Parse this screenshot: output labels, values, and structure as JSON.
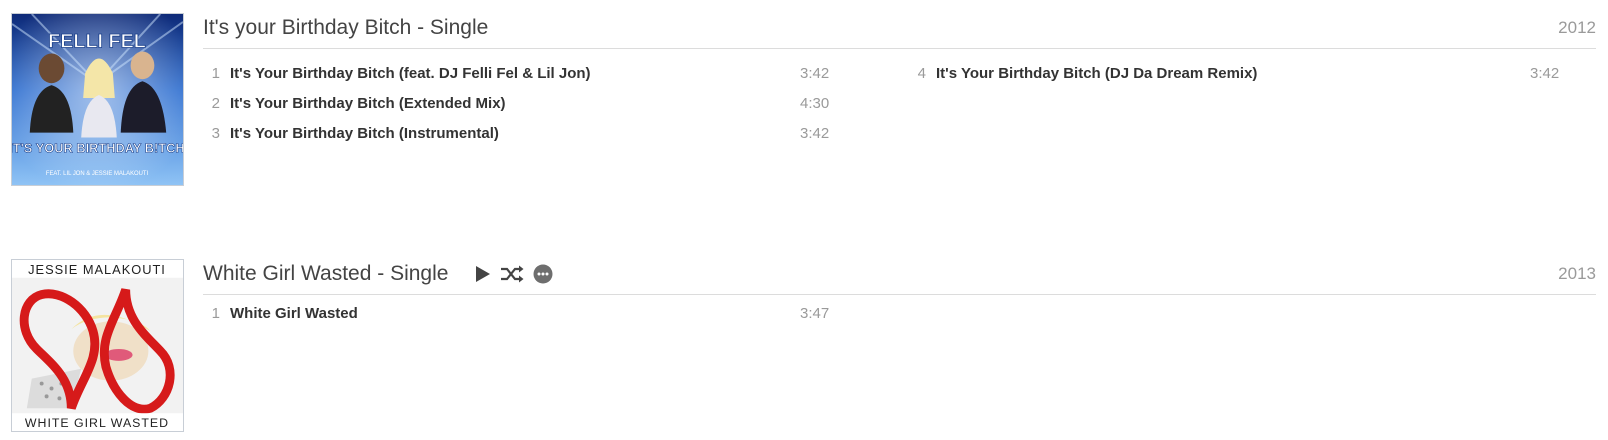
{
  "albums": [
    {
      "title": "It's your Birthday Bitch - Single",
      "year": "2012",
      "cover_text": {
        "artist": "FELLI FEL",
        "title": "IT'S YOUR BIRTHDAY B!TCH",
        "credit": "FEAT. LIL JON & JESSIE MALAKOUTI"
      },
      "tracks": [
        {
          "num": "1",
          "title": "It's Your Birthday Bitch (feat. DJ Felli Fel & Lil Jon)",
          "duration": "3:42"
        },
        {
          "num": "2",
          "title": "It's Your Birthday Bitch (Extended Mix)",
          "duration": "4:30"
        },
        {
          "num": "3",
          "title": "It's Your Birthday Bitch (Instrumental)",
          "duration": "3:42"
        },
        {
          "num": "4",
          "title": "It's Your Birthday Bitch (DJ Da Dream Remix)",
          "duration": "3:42"
        }
      ]
    },
    {
      "title": "White Girl Wasted - Single",
      "year": "2013",
      "cover_text": {
        "artist": "JESSIE MALAKOUTI",
        "title": "WHITE GIRL WASTED"
      },
      "controls": [
        "play-icon",
        "shuffle-icon",
        "more-icon"
      ],
      "tracks": [
        {
          "num": "1",
          "title": "White Girl Wasted",
          "duration": "3:47"
        }
      ]
    }
  ],
  "colors": {
    "cover1_bg": "#3a7fd8",
    "cover2_heart": "#d61a1a",
    "muted_text": "#9a9a9a"
  }
}
